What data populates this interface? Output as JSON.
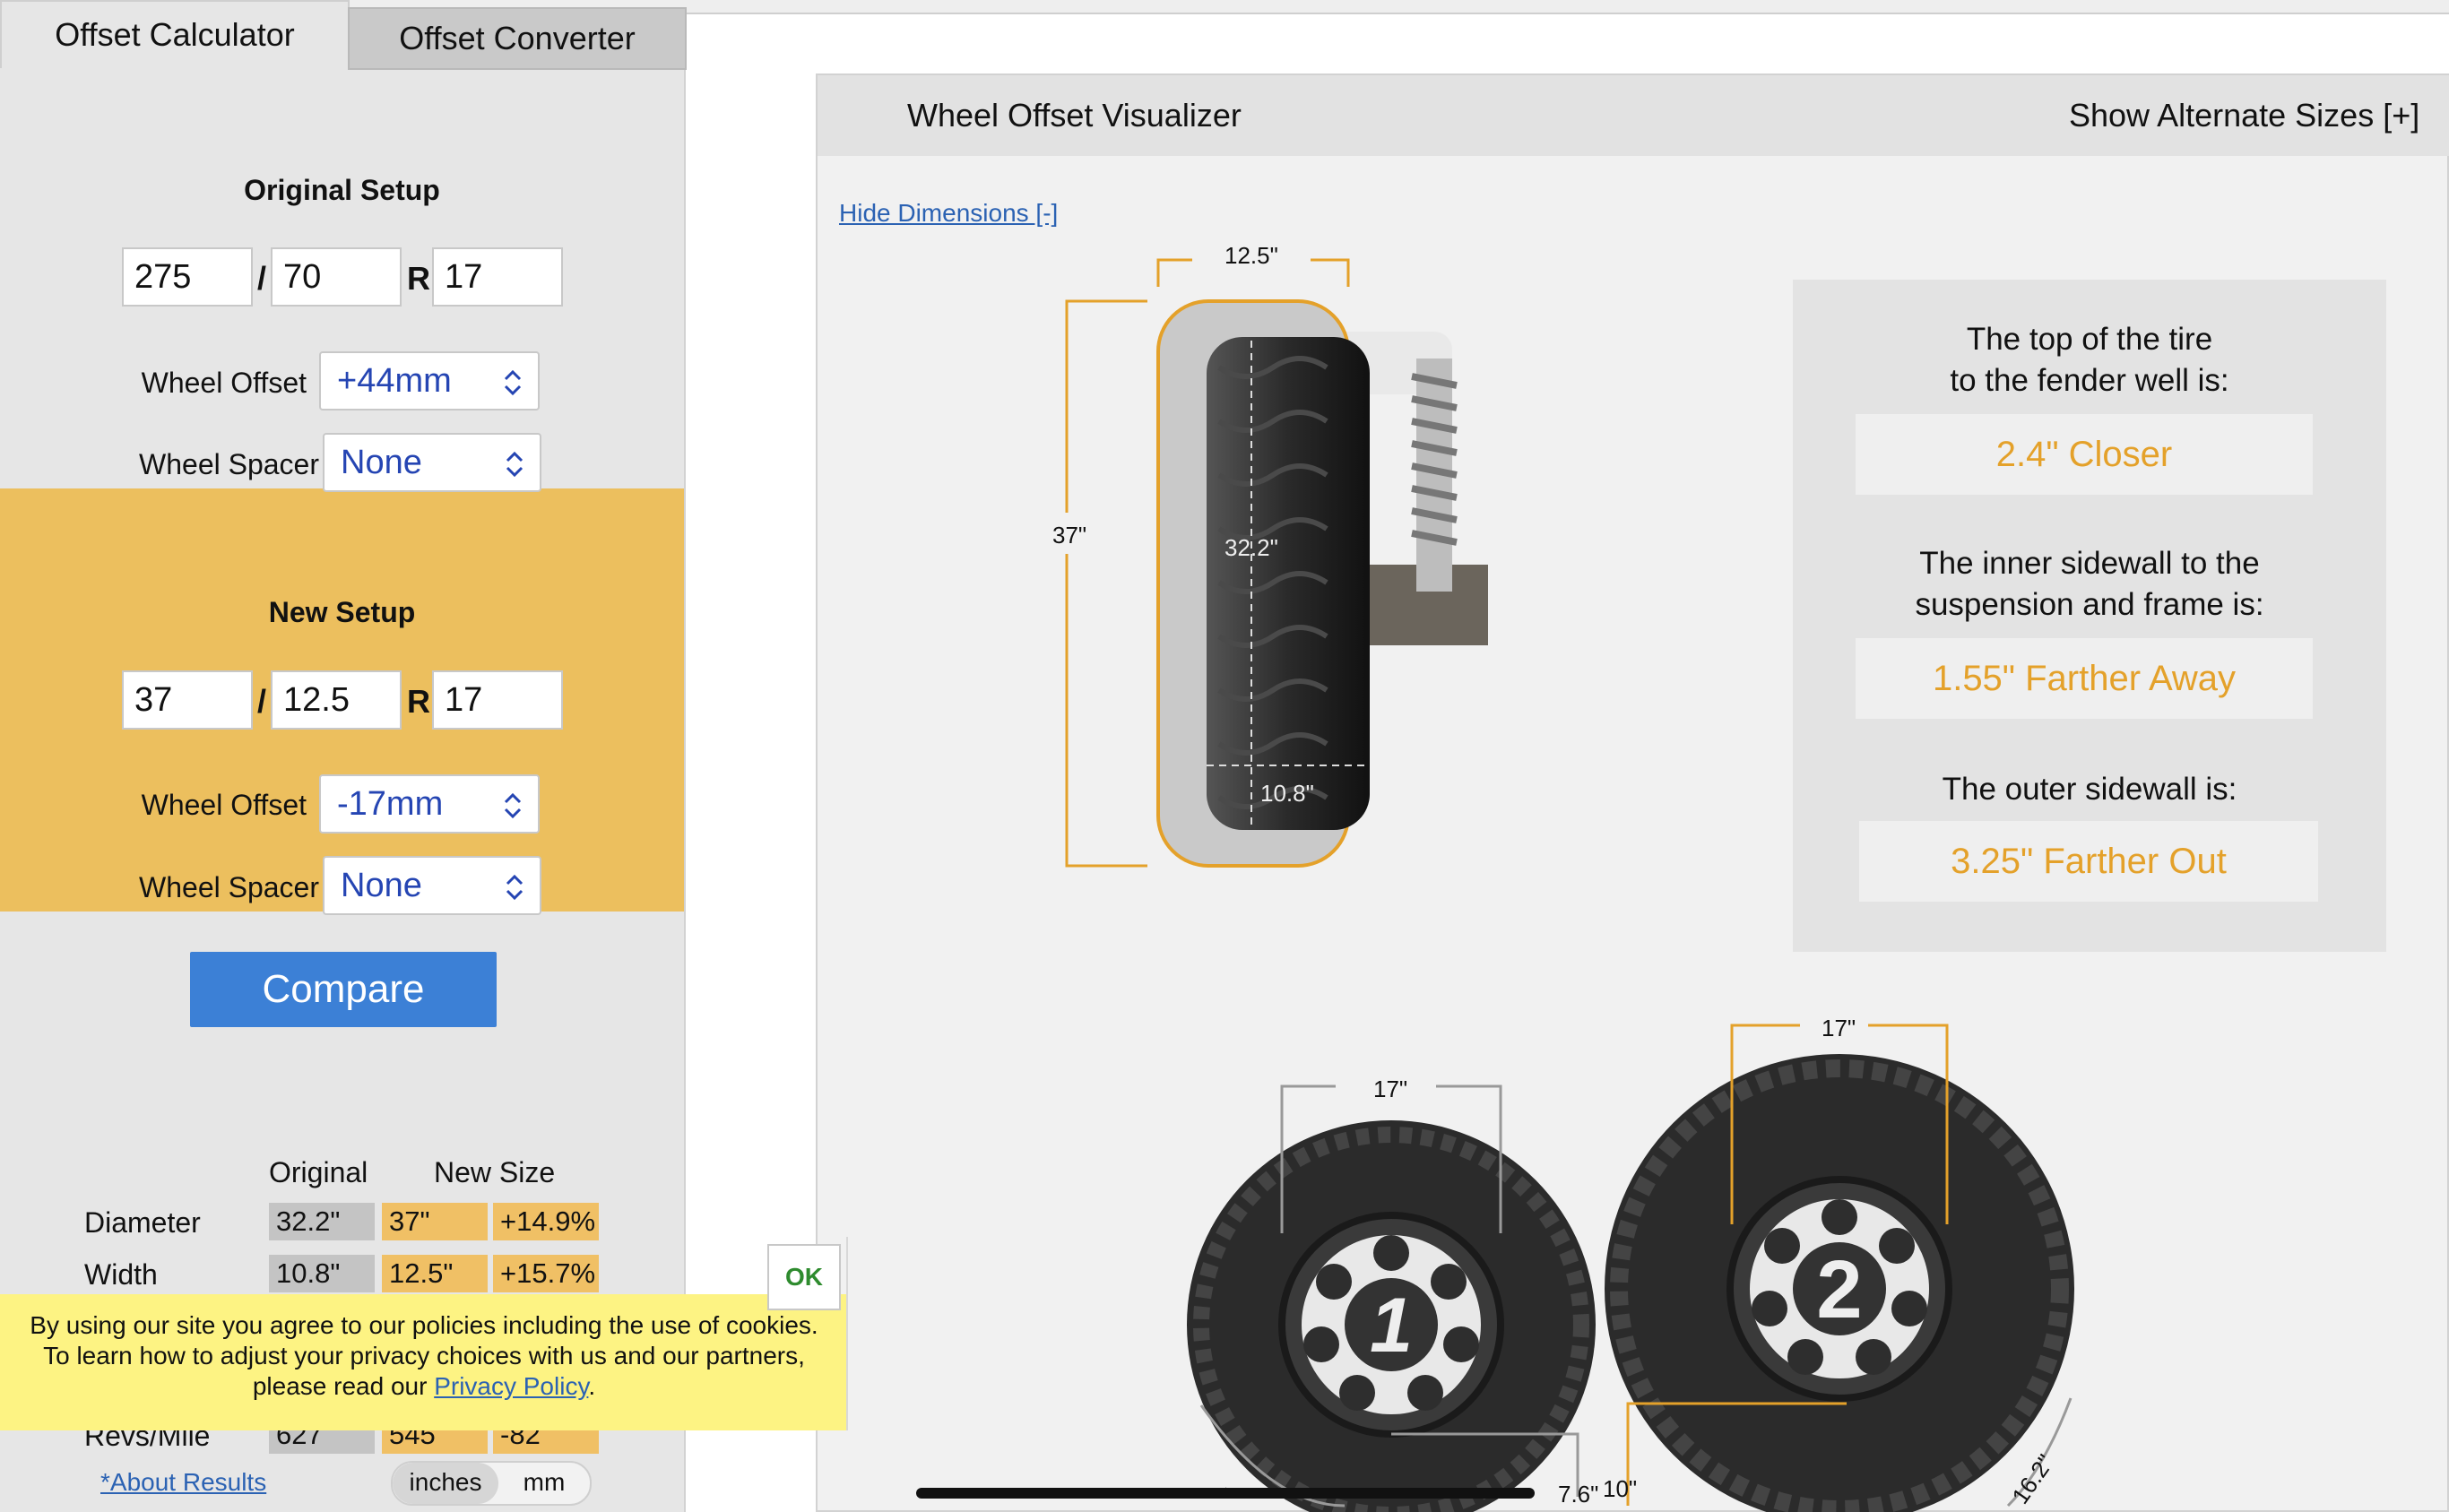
{
  "tabs": {
    "calculator": "Offset Calculator",
    "converter": "Offset Converter"
  },
  "original": {
    "title": "Original Setup",
    "width": "275",
    "aspect": "70",
    "rim": "17",
    "slash": "/",
    "r": "R",
    "offset_label": "Wheel Offset",
    "offset_value": "+44mm",
    "spacer_label": "Wheel Spacer",
    "spacer_value": "None"
  },
  "new_setup": {
    "title": "New Setup",
    "width": "37",
    "aspect": "12.5",
    "rim": "17",
    "slash": "/",
    "r": "R",
    "offset_label": "Wheel Offset",
    "offset_value": "-17mm",
    "spacer_label": "Wheel Spacer",
    "spacer_value": "None"
  },
  "compare_label": "Compare",
  "results": {
    "col_original": "Original",
    "col_new": "New Size",
    "rows": [
      {
        "label": "Diameter",
        "original": "32.2\"",
        "new": "37\"",
        "change": "+14.9%"
      },
      {
        "label": "Width",
        "original": "10.8\"",
        "new": "12.5\"",
        "change": "+15.7%"
      },
      {
        "label": "Revs/Mile",
        "original": "627",
        "new": "545",
        "change": "-82"
      }
    ],
    "about": "*About Results",
    "unit_inches": "inches",
    "unit_mm": "mm"
  },
  "cookie": {
    "text": "By using our site you agree to our policies including the use of cookies. To learn how to adjust your privacy choices with us and our partners, please read our",
    "link": "Privacy Policy",
    "end": ".",
    "ok": "OK"
  },
  "visualizer": {
    "title": "Wheel Offset Visualizer",
    "alt_sizes": "Show Alternate Sizes [+]",
    "hide_dims": "Hide Dimensions [-]",
    "dims": {
      "new_width": "12.5\"",
      "new_height": "37\"",
      "orig_height": "32.2\"",
      "orig_width": "10.8\"",
      "wheel1_rim": "17\"",
      "wheel2_rim": "17\"",
      "w1_bottom": "7.6\"",
      "w2_bottom": "10\"",
      "w1_arc": "\"",
      "w2_arc": "16.2\""
    },
    "wheel1_num": "1",
    "wheel2_num": "2",
    "info": [
      {
        "line1": "The top of the tire",
        "line2": "to the fender well is:",
        "value": "2.4\" Closer"
      },
      {
        "line1": "The inner sidewall to the",
        "line2": "suspension and frame is:",
        "value": "1.55\" Farther Away"
      },
      {
        "line1": "The outer sidewall is:",
        "line2": "",
        "value": "3.25\" Farther Out"
      }
    ]
  },
  "colors": {
    "accent_gold": "#ecbf5e",
    "value_orange": "#e4a12a",
    "button_blue": "#3c80d6",
    "link_blue": "#2b62b3"
  }
}
